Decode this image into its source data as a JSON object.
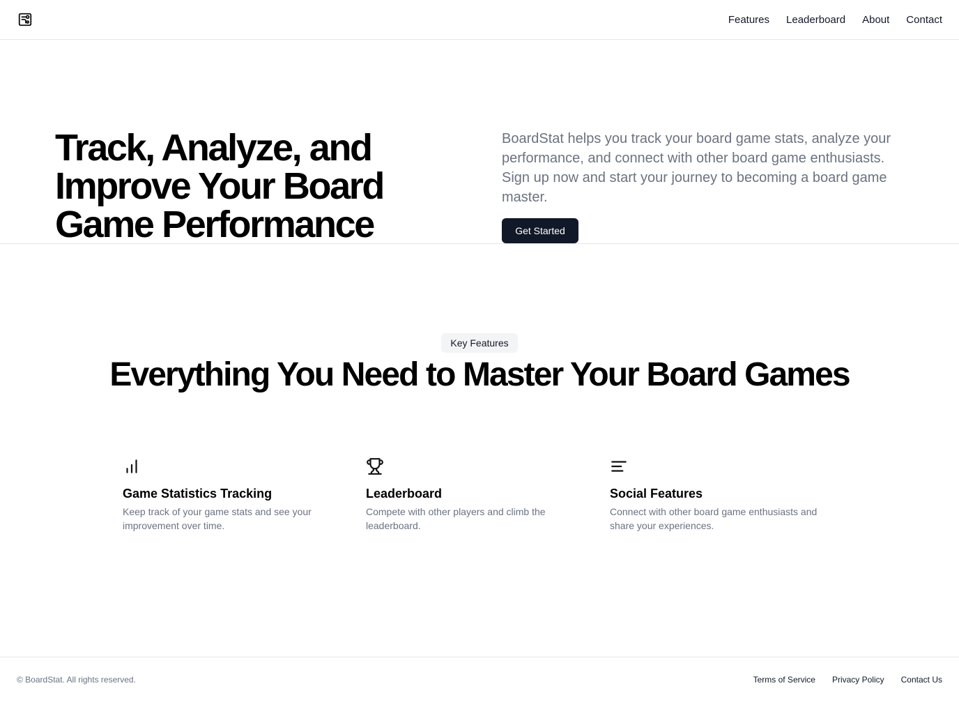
{
  "header": {
    "logo_icon": "board-game-logo-icon",
    "nav": [
      {
        "label": "Features"
      },
      {
        "label": "Leaderboard"
      },
      {
        "label": "About"
      },
      {
        "label": "Contact"
      }
    ]
  },
  "hero": {
    "title": "Track, Analyze, and Improve Your Board Game Performance",
    "description": "BoardStat helps you track your board game stats, analyze your performance, and connect with other board game enthusiasts. Sign up now and start your journey to becoming a board game master.",
    "cta_label": "Get Started"
  },
  "features": {
    "badge": "Key Features",
    "title": "Everything You Need to Master Your Board Games",
    "items": [
      {
        "icon": "bar-chart-icon",
        "title": "Game Statistics Tracking",
        "description": "Keep track of your game stats and see your improvement over time."
      },
      {
        "icon": "trophy-icon",
        "title": "Leaderboard",
        "description": "Compete with other players and climb the leaderboard."
      },
      {
        "icon": "text-lines-icon",
        "title": "Social Features",
        "description": "Connect with other board game enthusiasts and share your experiences."
      }
    ]
  },
  "footer": {
    "copyright": "© BoardStat. All rights reserved.",
    "links": [
      {
        "label": "Terms of Service"
      },
      {
        "label": "Privacy Policy"
      },
      {
        "label": "Contact Us"
      }
    ]
  },
  "colors": {
    "primary": "#111827",
    "muted_text": "#6b7280",
    "border": "#e5e7eb",
    "badge_bg": "#f3f4f6"
  }
}
